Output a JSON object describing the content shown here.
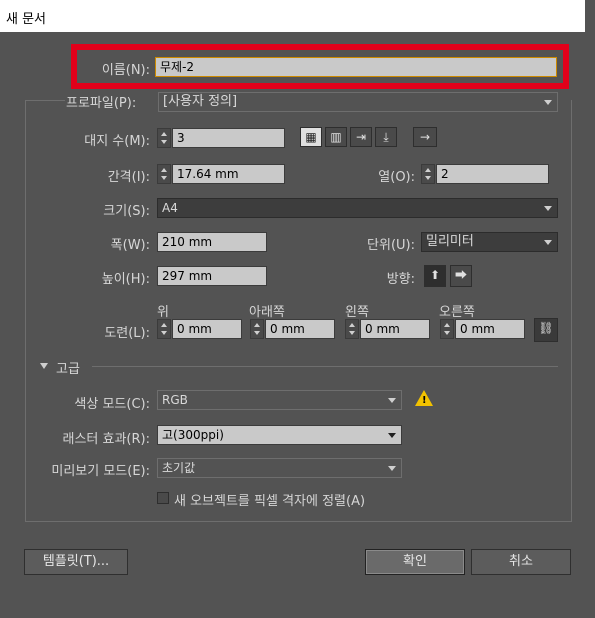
{
  "title": "새 문서",
  "name": {
    "label": "이름(N):",
    "value": "무제-2"
  },
  "profile": {
    "label": "프로파일(P):",
    "value": "[사용자 정의]"
  },
  "artboards": {
    "label": "대지 수(M):",
    "value": "3",
    "arrow_glyph": "→"
  },
  "spacing": {
    "label": "간격(I):",
    "value": "17.64 mm"
  },
  "columns": {
    "label": "열(O):",
    "value": "2"
  },
  "size": {
    "label": "크기(S):",
    "value": "A4"
  },
  "width": {
    "label": "폭(W):",
    "value": "210 mm"
  },
  "units": {
    "label": "단위(U):",
    "value": "밀리미터"
  },
  "height": {
    "label": "높이(H):",
    "value": "297 mm"
  },
  "orientation": {
    "label": "방향:"
  },
  "bleed": {
    "label": "도련(L):",
    "top": {
      "label": "위",
      "value": "0 mm"
    },
    "bottom": {
      "label": "아래쪽",
      "value": "0 mm"
    },
    "left": {
      "label": "왼쪽",
      "value": "0 mm"
    },
    "right": {
      "label": "오른쪽",
      "value": "0 mm"
    }
  },
  "advanced": {
    "label": "고급",
    "color_mode": {
      "label": "색상 모드(C):",
      "value": "RGB"
    },
    "raster": {
      "label": "래스터 효과(R):",
      "value": "고(300ppi)"
    },
    "preview": {
      "label": "미리보기 모드(E):",
      "value": "초기값"
    },
    "align_pixel": {
      "label": "새 오브젝트를 픽셀 격자에 정렬(A)"
    }
  },
  "buttons": {
    "templates": "템플릿(T)...",
    "ok": "확인",
    "cancel": "취소"
  },
  "colors": {
    "highlight": "#e1001a",
    "warning": "#f2c200"
  }
}
